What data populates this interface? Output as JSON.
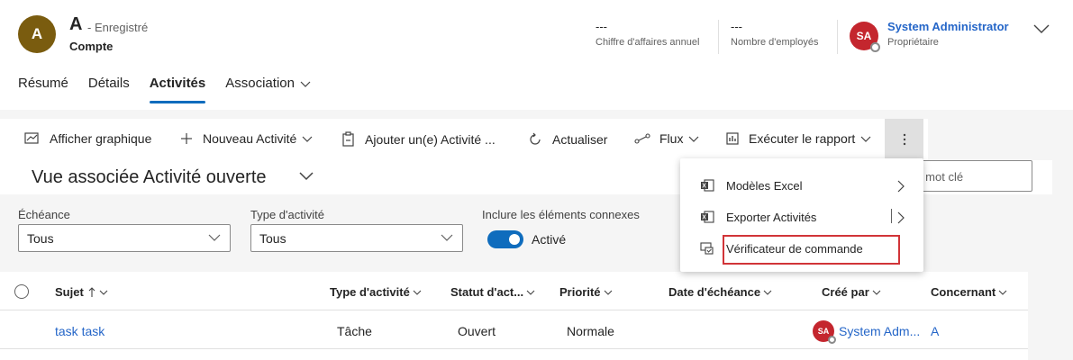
{
  "record": {
    "avatar_initial": "A",
    "title": "A",
    "saved_status": "- Enregistré",
    "entity_type": "Compte"
  },
  "header_fields": [
    {
      "value": "---",
      "label": "Chiffre d'affaires annuel"
    },
    {
      "value": "---",
      "label": "Nombre d'employés"
    }
  ],
  "owner": {
    "initials": "SA",
    "name": "System Administrator",
    "role": "Propriétaire"
  },
  "tabs": [
    {
      "label": "Résumé",
      "active": false
    },
    {
      "label": "Détails",
      "active": false
    },
    {
      "label": "Activités",
      "active": true
    },
    {
      "label": "Association",
      "active": false
    }
  ],
  "commands": {
    "show_chart": "Afficher graphique",
    "new_activity": "Nouveau Activité",
    "add_activity": "Ajouter un(e) Activité ...",
    "refresh": "Actualiser",
    "flow": "Flux",
    "run_report": "Exécuter le rapport"
  },
  "view": {
    "title": "Vue associée Activité ouverte",
    "search_placeholder": "ar mot clé"
  },
  "filters": {
    "due_label": "Échéance",
    "due_value": "Tous",
    "type_label": "Type d'activité",
    "type_value": "Tous",
    "related_label": "Inclure les éléments connexes",
    "related_toggle_label": "Activé"
  },
  "grid": {
    "columns": [
      "Sujet",
      "Type d'activité",
      "Statut d'act...",
      "Priorité",
      "Date d'échéance",
      "Créé par",
      "Concernant"
    ],
    "rows": [
      {
        "subject": "task task",
        "type": "Tâche",
        "status": "Ouvert",
        "priority": "Normale",
        "due": "",
        "created_by_initials": "SA",
        "created_by": "System Adm...",
        "regarding": "A"
      }
    ]
  },
  "menu": {
    "items": [
      {
        "label": "Modèles Excel"
      },
      {
        "label": "Exporter Activités"
      },
      {
        "label": "Vérificateur de commande"
      }
    ]
  },
  "colors": {
    "accent": "#0f6cbd",
    "link": "#2566c8",
    "avatar_record": "#7a5c0f",
    "avatar_owner": "#c4262e",
    "highlight": "#d13438"
  }
}
